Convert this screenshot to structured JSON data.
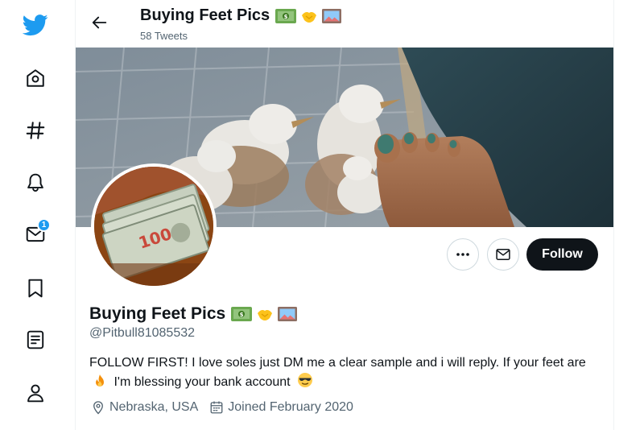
{
  "profile": {
    "display_name": "Buying Feet Pics",
    "tweet_count": "58 Tweets",
    "handle": "@Pitbull81085532",
    "bio_part1": "FOLLOW FIRST! I love soles just DM me a clear sample and i will reply. If your feet are",
    "bio_part2": "I'm blessing your bank account",
    "location": "Nebraska, USA",
    "joined": "Joined February 2020",
    "name_emojis": [
      "money-icon",
      "handshake-icon",
      "picture-icon"
    ]
  },
  "actions": {
    "follow_label": "Follow"
  },
  "nav": {
    "items": [
      "twitter-logo",
      "home-icon",
      "explore-icon",
      "notifications-icon",
      "messages-icon",
      "bookmarks-icon",
      "lists-icon",
      "profile-icon"
    ],
    "messages_badge": "1"
  },
  "colors": {
    "brand": "#1d9bf0",
    "text": "#0f1419",
    "secondary": "#536471",
    "follow_bg": "#0f1419"
  }
}
